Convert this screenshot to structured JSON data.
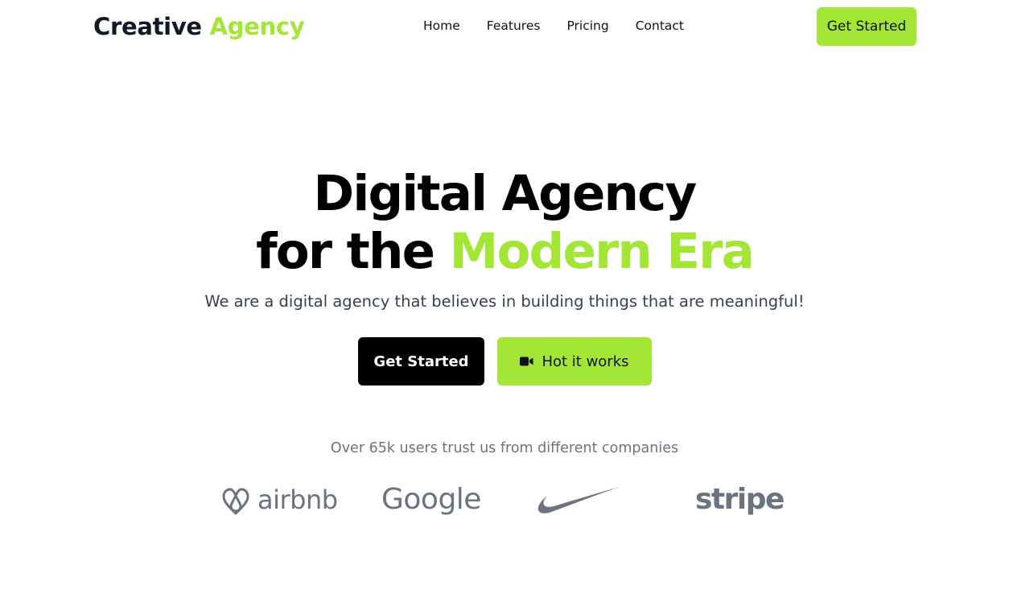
{
  "brand": {
    "name_part1": "Creative",
    "name_part2": "Agency",
    "accent_color": "#a3e635",
    "dark_color": "#111827"
  },
  "nav": {
    "items": [
      {
        "label": "Home"
      },
      {
        "label": "Features"
      },
      {
        "label": "Pricing"
      },
      {
        "label": "Contact"
      }
    ],
    "cta_label": "Get Started"
  },
  "hero": {
    "line1": "Digital Agency",
    "line2_prefix": "for the",
    "line2_highlight": "Modern Era",
    "subtitle": "We are a digital agency that believes in building things that are meaningful!",
    "primary_button": "Get Started",
    "secondary_button": "Hot it works",
    "secondary_button_icon": "video-camera-icon"
  },
  "trust": {
    "text": "Over 65k users trust us from different companies",
    "logos": [
      {
        "name": "airbnb",
        "icon": "airbnb-logo"
      },
      {
        "name": "Google",
        "icon": "google-logo"
      },
      {
        "name": "Nike",
        "icon": "nike-swoosh-logo"
      },
      {
        "name": "stripe",
        "icon": "stripe-logo"
      }
    ],
    "logo_color": "#6b7280"
  }
}
